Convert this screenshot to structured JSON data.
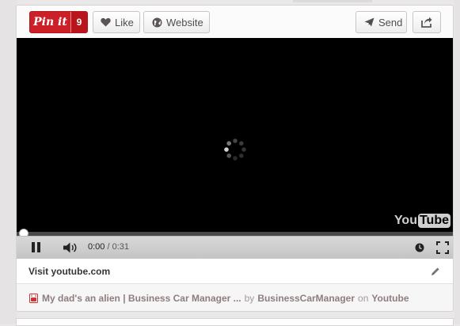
{
  "toolbar": {
    "pinit_label": "Pin it",
    "pinit_count": "9",
    "like_label": "Like",
    "website_label": "Website",
    "send_label": "Send"
  },
  "player": {
    "brand_left": "You",
    "brand_right": "Tube",
    "current_time": "0:00",
    "separator": " / ",
    "duration": "0:31",
    "progress_fraction": 0
  },
  "visit": {
    "label": "Visit youtube.com"
  },
  "source": {
    "title": "My dad's an alien | Business Car Manager ...",
    "by_word": "by",
    "author": "BusinessCarManager",
    "on_word": "on",
    "site": "Youtube"
  },
  "colors": {
    "pinit_red": "#cb2027",
    "player_bg": "#000000",
    "controls_bg": "#d0d0d0"
  }
}
